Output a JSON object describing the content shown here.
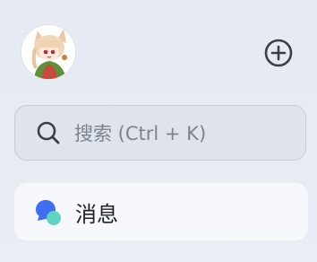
{
  "header": {
    "avatar_alt": "user avatar",
    "add_icon": "plus-circle-icon"
  },
  "search": {
    "placeholder": "搜索 (Ctrl + K)",
    "icon": "search-icon"
  },
  "nav": {
    "items": [
      {
        "label": "消息",
        "icon": "message-bubble-icon",
        "active": true
      }
    ]
  },
  "colors": {
    "background": "#e6eaf2",
    "search_bg": "#dfe4ec",
    "search_border": "#c6ccd6",
    "active_item_bg": "#f6f8fc",
    "message_icon_blue": "#3f6ff0",
    "message_icon_teal": "#5ed4c1",
    "icon_dark": "#3a3f48"
  }
}
